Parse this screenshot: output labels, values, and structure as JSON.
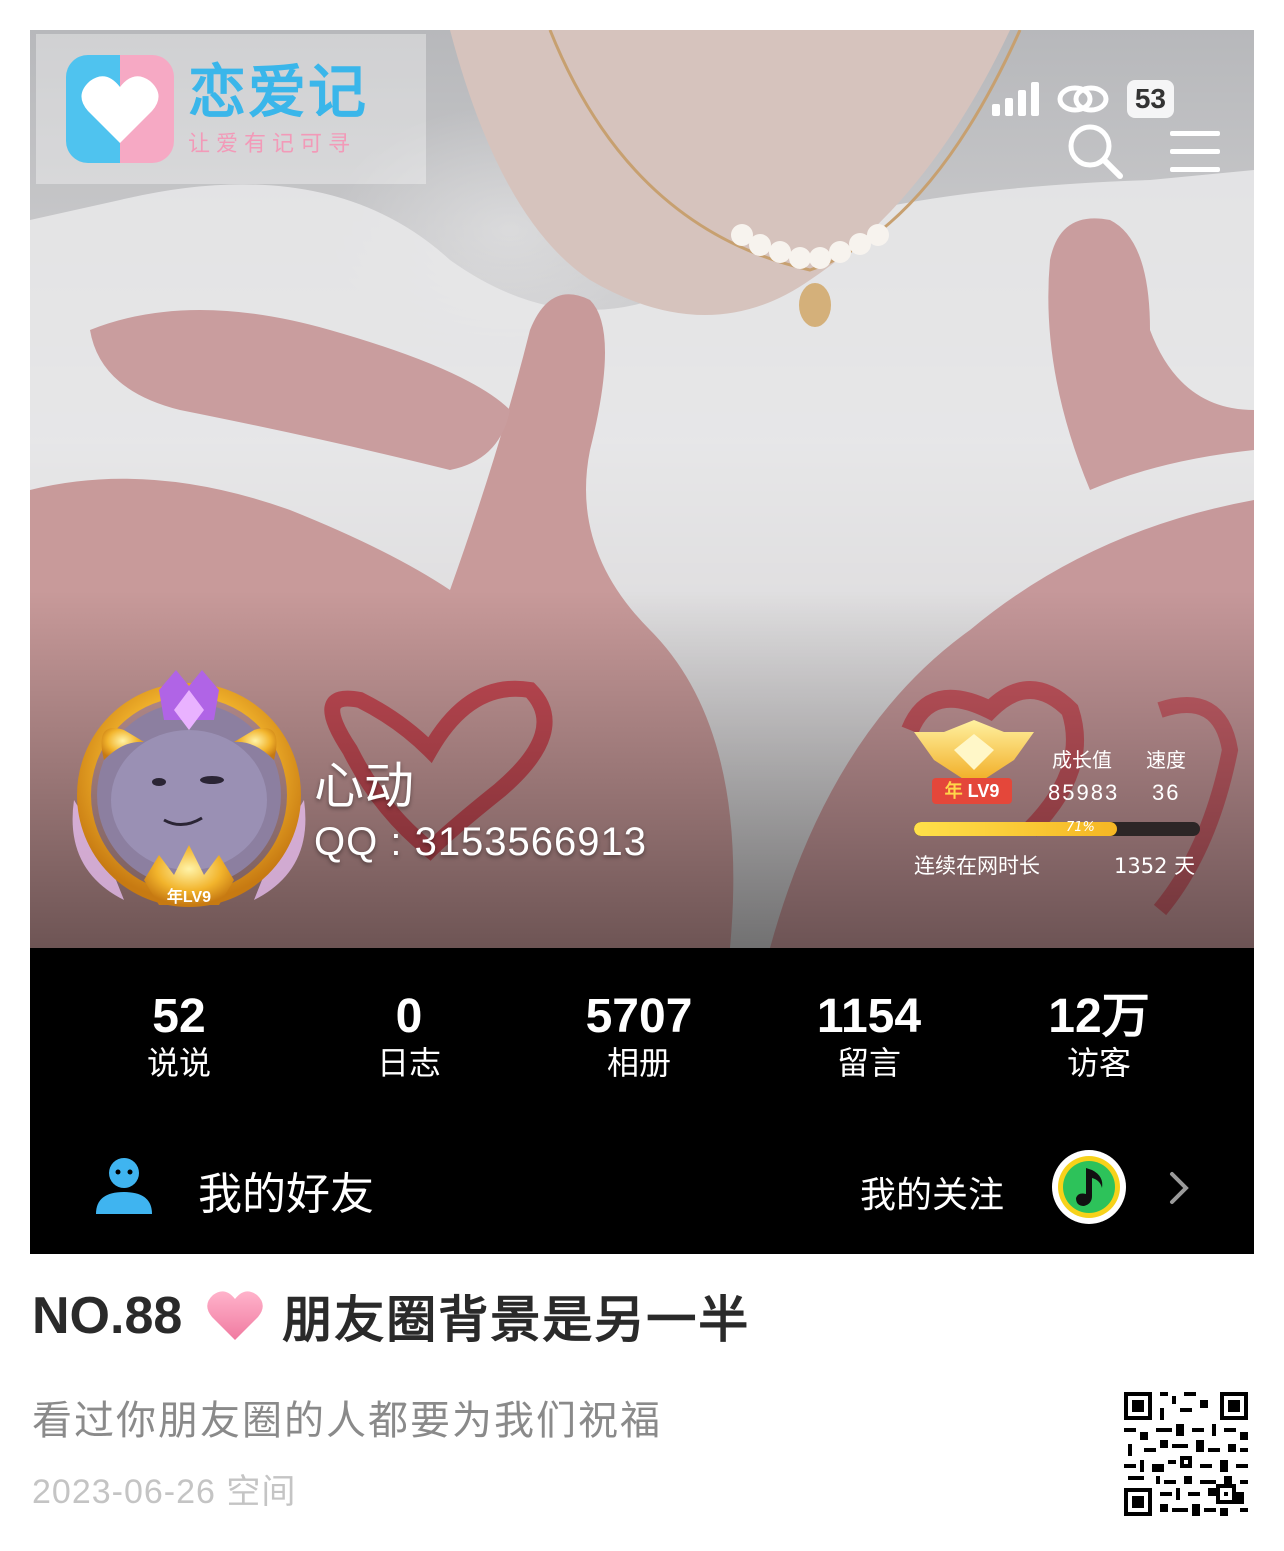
{
  "watermark": {
    "title": "恋爱记",
    "subtitle": "让爱有记可寻"
  },
  "status_bar": {
    "battery": "53"
  },
  "profile": {
    "name": "心动",
    "qq": "QQ : 3153566913",
    "avatar_badge": "年LV9"
  },
  "level": {
    "badge_prefix": "年",
    "badge_level": "LV9",
    "growth_label": "成长值",
    "speed_label": "速度",
    "growth_value": "85983",
    "speed_value": "36",
    "progress_percent": 71,
    "progress_label": "71%",
    "online_label": "连续在网时长",
    "online_days": "1352 天"
  },
  "stats": [
    {
      "value": "52",
      "label": "说说"
    },
    {
      "value": "0",
      "label": "日志"
    },
    {
      "value": "5707",
      "label": "相册"
    },
    {
      "value": "1154",
      "label": "留言"
    },
    {
      "value": "12万",
      "label": "访客"
    }
  ],
  "friends_row": {
    "friends_label": "我的好友",
    "follow_label": "我的关注"
  },
  "article": {
    "number": "NO.88",
    "title": "朋友圈背景是另一半",
    "subtitle": "看过你朋友圈的人都要为我们祝福",
    "meta": "2023-06-26 空间"
  },
  "colors": {
    "accent_blue": "#3ab6ea",
    "accent_pink": "#f6a9c4",
    "progress_yellow": "#f5c42e",
    "heart_pink": "#f48fb1"
  },
  "icons": [
    "heart-logo-icon",
    "signal-icon",
    "link-icon",
    "search-icon",
    "menu-icon",
    "friend-icon",
    "music-note-icon",
    "chevron-right-icon",
    "heart-icon",
    "qr-code"
  ]
}
